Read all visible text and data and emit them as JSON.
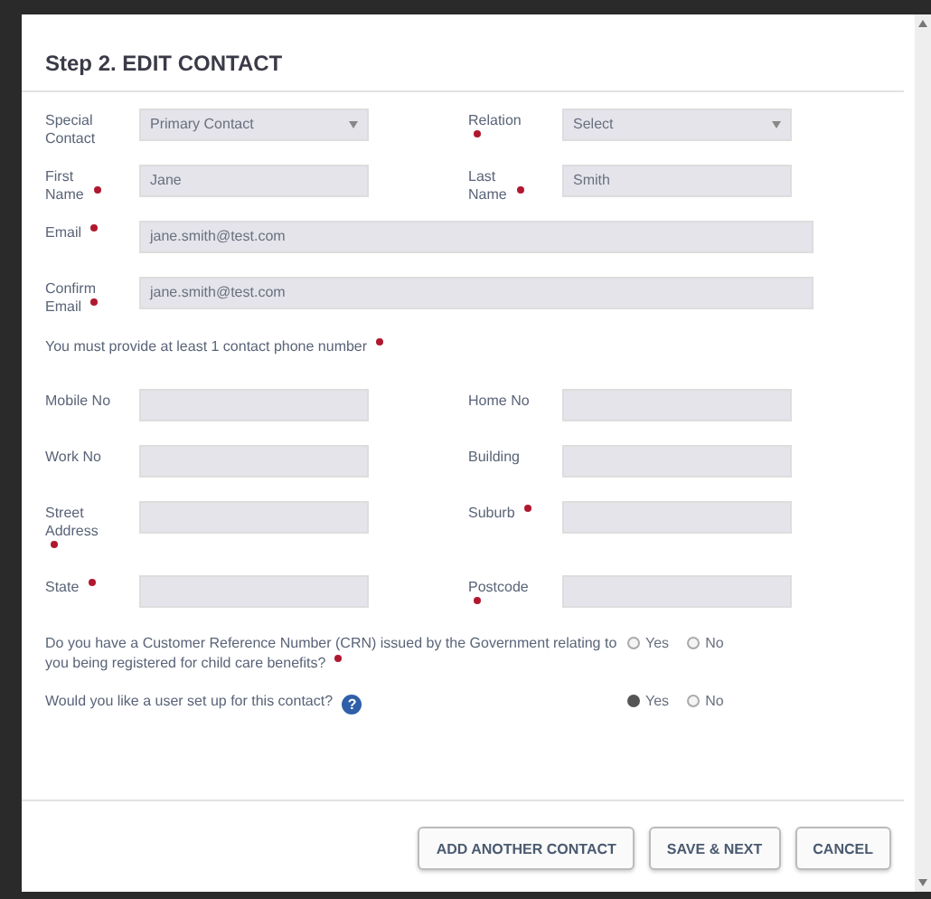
{
  "title": "Step 2. EDIT CONTACT",
  "rows": [
    [
      {
        "label": "Special Contact",
        "kind": "select",
        "value": "Primary Contact"
      },
      {
        "label": "Relation",
        "kind": "select",
        "value": "Select",
        "required": true
      }
    ],
    [
      {
        "label": "First Name",
        "kind": "input",
        "value": "Jane",
        "required": true
      },
      {
        "label": "Last Name",
        "kind": "input",
        "value": "Smith",
        "required": true
      }
    ],
    [
      {
        "label": "Email",
        "kind": "wide",
        "value": "jane.smith@test.com",
        "required": true
      }
    ],
    [
      {
        "label": "Confirm Email",
        "kind": "wide",
        "value": "jane.smith@test.com",
        "required": true
      }
    ],
    [
      {
        "label": "You must provide at least 1 contact phone number",
        "kind": "note",
        "required": true
      }
    ],
    [
      {
        "label": "Mobile No",
        "kind": "input"
      },
      {
        "label": "Home No",
        "kind": "input"
      }
    ],
    [
      {
        "label": "Work No",
        "kind": "input"
      },
      {
        "label": "Building",
        "kind": "input"
      }
    ],
    [
      {
        "label": "Street Address",
        "kind": "input",
        "required": true
      },
      {
        "label": "Suburb",
        "kind": "input",
        "required": true
      }
    ],
    [
      {
        "label": "State",
        "kind": "input",
        "required": true
      },
      {
        "label": "Postcode",
        "kind": "input",
        "required": true
      }
    ]
  ],
  "questions": [
    {
      "text": "Do you have a Customer Reference Number (CRN) issued by the Government relating to you being registered for child care benefits?",
      "required": true,
      "options": [
        {
          "label": "Yes",
          "selected": false
        },
        {
          "label": "No",
          "selected": false
        }
      ]
    },
    {
      "text": "Would you like a user set up for this contact?",
      "help": true,
      "help_icon": "?",
      "options": [
        {
          "label": "Yes",
          "selected": true
        },
        {
          "label": "No",
          "selected": false
        }
      ]
    }
  ],
  "buttons": [
    "ADD ANOTHER CONTACT",
    "SAVE & NEXT",
    "CANCEL"
  ]
}
